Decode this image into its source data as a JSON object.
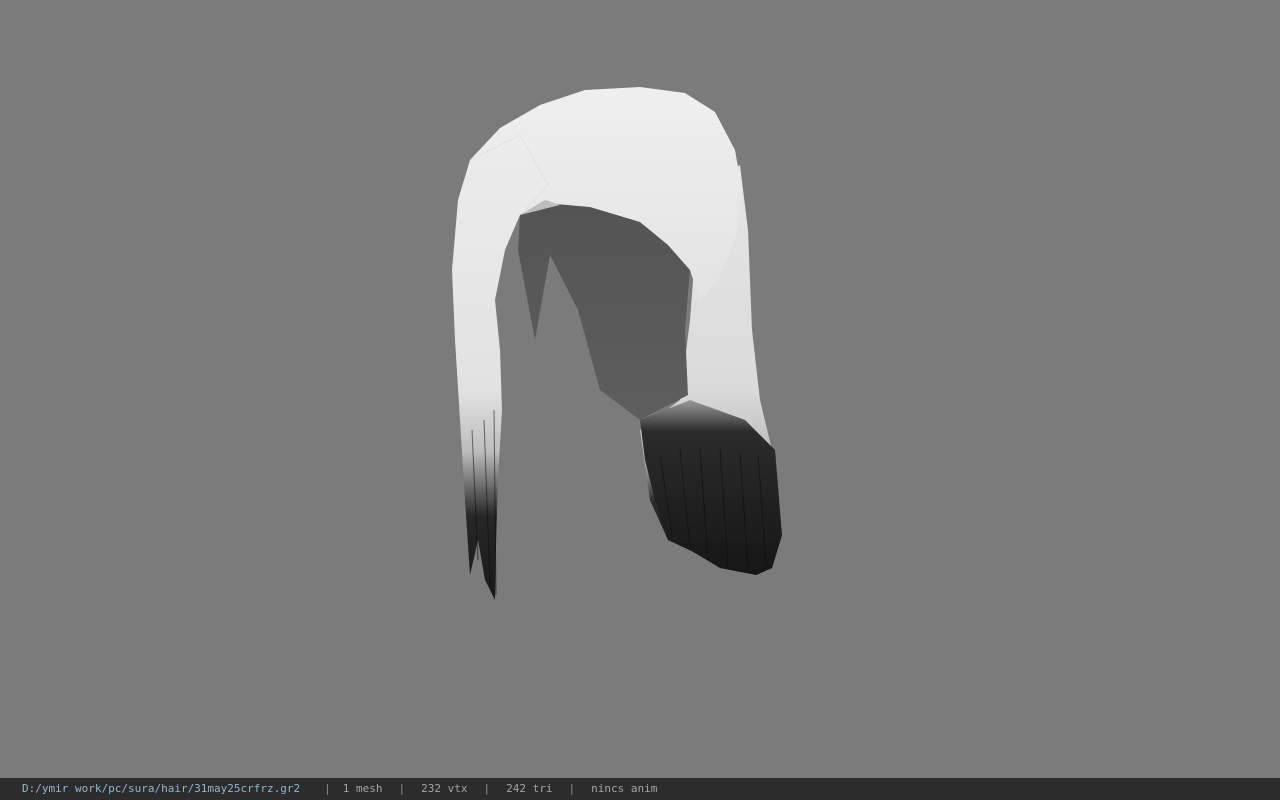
{
  "viewer": {
    "background_color": "#7b7b7b"
  },
  "model": {
    "name": "hair-mesh"
  },
  "status_bar": {
    "file_path": "D:/ymir work/pc/sura/hair/31may25crfrz.gr2",
    "separator": "|",
    "mesh_count": "1 mesh",
    "vertex_count": "232 vtx",
    "triangle_count": "242 tri",
    "animation": "nincs anim",
    "background": "#2c2c2c",
    "text_color": "#a5a5a5",
    "path_color": "#8fb6d4"
  }
}
